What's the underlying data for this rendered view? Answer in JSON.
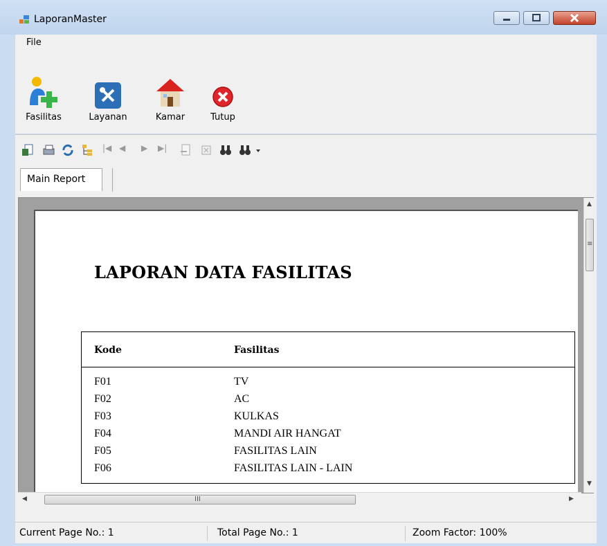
{
  "window": {
    "title": "LaporanMaster"
  },
  "menu": {
    "file_label": "File"
  },
  "toolbar": {
    "items": [
      {
        "label": "Fasilitas",
        "icon": "add-user-icon"
      },
      {
        "label": "Layanan",
        "icon": "tools-icon"
      },
      {
        "label": "Kamar",
        "icon": "house-icon"
      },
      {
        "label": "Tutup",
        "icon": "close-circle-icon"
      }
    ]
  },
  "report_toolbar": {
    "icons": [
      "export-icon",
      "print-icon",
      "refresh-icon",
      "group-tree-icon",
      "first-page-icon",
      "previous-page-icon",
      "next-page-icon",
      "last-page-icon",
      "goto-page-icon",
      "stop-icon",
      "find-icon",
      "zoom-icon"
    ]
  },
  "tab": {
    "label": "Main Report"
  },
  "report": {
    "title": "LAPORAN DATA FASILITAS",
    "columns": [
      "Kode",
      "Fasilitas"
    ],
    "rows": [
      [
        "F01",
        "TV"
      ],
      [
        "F02",
        "AC"
      ],
      [
        "F03",
        "KULKAS"
      ],
      [
        "F04",
        "MANDI AIR HANGAT"
      ],
      [
        "F05",
        "FASILITAS LAIN"
      ],
      [
        "F06",
        "FASILITAS LAIN - LAIN"
      ]
    ]
  },
  "scrollbar": {
    "h_grip": "III",
    "v_grip": "≡"
  },
  "status": {
    "current_page": "Current Page No.: 1",
    "total_page": "Total Page No.: 1",
    "zoom": "Zoom Factor: 100%"
  },
  "colors": {
    "title_bar": "#c9dcf1",
    "close_button": "#c4412a",
    "panel": "#f0f0f0"
  }
}
